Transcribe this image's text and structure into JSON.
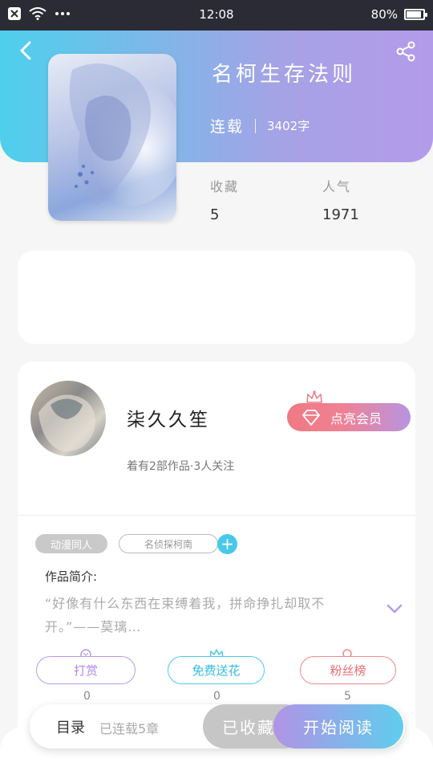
{
  "status_bar": {
    "time": "12:08",
    "battery": "80%",
    "battery_level": 0.8,
    "left_icons": [
      "notification-x-icon",
      "wifi-icon",
      "more-dots-icon"
    ]
  },
  "book": {
    "title": "名柯生存法则",
    "status": "连载",
    "word_count": "3402字",
    "stats": [
      {
        "label": "收藏",
        "value": "5"
      },
      {
        "label": "人气",
        "value": "1971"
      }
    ]
  },
  "author": {
    "name": "柒久久笙",
    "meta": "着有2部作品·3人关注",
    "vip_button": "点亮会员"
  },
  "tags": [
    "动漫同人",
    "名侦探柯南"
  ],
  "intro": {
    "label": "作品简介:",
    "text": "“好像有什么东西在束缚着我，拼命挣扎却取不开。”——莫璃…"
  },
  "actions": [
    {
      "label": "打赏",
      "count": "0",
      "icon": "coin-icon"
    },
    {
      "label": "免费送花",
      "count": "0",
      "icon": "flower-icon"
    },
    {
      "label": "粉丝榜",
      "count": "5",
      "icon": "medal-icon"
    }
  ],
  "bottom": {
    "toc_label": "目录",
    "toc_meta": "已连载5章",
    "collected": "已收藏",
    "read": "开始阅读"
  },
  "colors": {
    "header_start": "#4dd0ec",
    "header_end": "#b49bea",
    "vip_start": "#f07983",
    "accent_cyan": "#47c8ea"
  }
}
